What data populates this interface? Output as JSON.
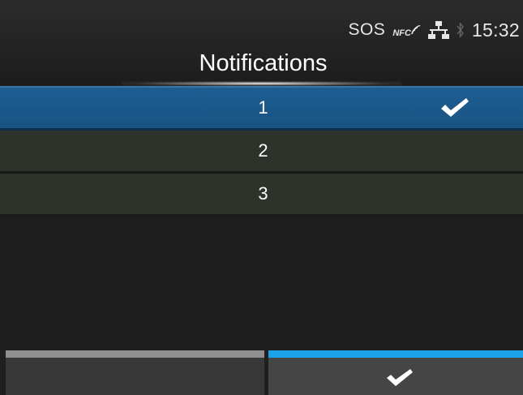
{
  "status_bar": {
    "sos_label": "SOS",
    "nfc_label": "NFC",
    "nfc_icon": "nfc-signal-icon",
    "network_icon": "lan-network-icon",
    "bluetooth_icon": "bluetooth-icon",
    "time": "15:32"
  },
  "header": {
    "title": "Notifications"
  },
  "list": {
    "items": [
      {
        "label": "1",
        "selected": true
      },
      {
        "label": "2",
        "selected": false
      },
      {
        "label": "3",
        "selected": false
      }
    ]
  },
  "softkeys": {
    "left": {
      "label": ""
    },
    "right": {
      "icon": "checkmark-icon"
    }
  },
  "colors": {
    "selected_row": "#1f5d93",
    "row": "#2d332b",
    "active_softkey_bar": "#1aa3e8",
    "inactive_softkey_bar": "#8f8f8f",
    "background": "#1f1f1f"
  }
}
